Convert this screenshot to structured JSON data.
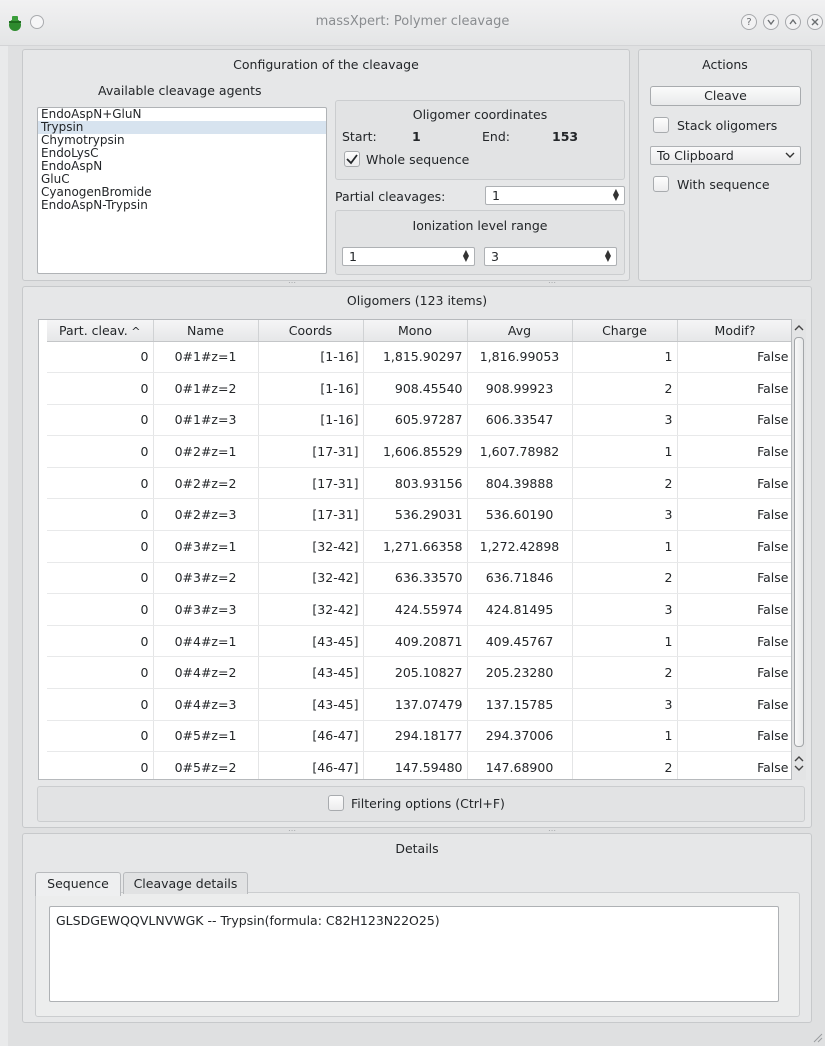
{
  "window": {
    "title": "massXpert: Polymer cleavage"
  },
  "config": {
    "title": "Configuration of the cleavage",
    "agents_label": "Available cleavage agents",
    "agents": [
      "EndoAspN+GluN",
      "Trypsin",
      "Chymotrypsin",
      "EndoLysC",
      "EndoAspN",
      "GluC",
      "CyanogenBromide",
      "EndoAspN-Trypsin"
    ],
    "selected_agent": "Trypsin",
    "coords": {
      "title": "Oligomer coordinates",
      "start_label": "Start:",
      "start_value": "1",
      "end_label": "End:",
      "end_value": "153",
      "whole_sequence_label": "Whole sequence",
      "whole_sequence_checked": true
    },
    "partial_label": "Partial cleavages:",
    "partial_value": "1",
    "ionization": {
      "title": "Ionization level range",
      "min": "1",
      "max": "3"
    }
  },
  "actions": {
    "title": "Actions",
    "cleave_label": "Cleave",
    "stack_label": "Stack oligomers",
    "export_target": "To Clipboard",
    "with_sequence_label": "With sequence"
  },
  "oligomers": {
    "title": "Oligomers (123 items)",
    "columns": [
      "Part. cleav.",
      "Name",
      "Coords",
      "Mono",
      "Avg",
      "Charge",
      "Modif?"
    ],
    "rows": [
      [
        "0",
        "0#1#z=1",
        "[1-16]",
        "1,815.90297",
        "1,816.99053",
        "1",
        "False"
      ],
      [
        "0",
        "0#1#z=2",
        "[1-16]",
        "908.45540",
        "908.99923",
        "2",
        "False"
      ],
      [
        "0",
        "0#1#z=3",
        "[1-16]",
        "605.97287",
        "606.33547",
        "3",
        "False"
      ],
      [
        "0",
        "0#2#z=1",
        "[17-31]",
        "1,606.85529",
        "1,607.78982",
        "1",
        "False"
      ],
      [
        "0",
        "0#2#z=2",
        "[17-31]",
        "803.93156",
        "804.39888",
        "2",
        "False"
      ],
      [
        "0",
        "0#2#z=3",
        "[17-31]",
        "536.29031",
        "536.60190",
        "3",
        "False"
      ],
      [
        "0",
        "0#3#z=1",
        "[32-42]",
        "1,271.66358",
        "1,272.42898",
        "1",
        "False"
      ],
      [
        "0",
        "0#3#z=2",
        "[32-42]",
        "636.33570",
        "636.71846",
        "2",
        "False"
      ],
      [
        "0",
        "0#3#z=3",
        "[32-42]",
        "424.55974",
        "424.81495",
        "3",
        "False"
      ],
      [
        "0",
        "0#4#z=1",
        "[43-45]",
        "409.20871",
        "409.45767",
        "1",
        "False"
      ],
      [
        "0",
        "0#4#z=2",
        "[43-45]",
        "205.10827",
        "205.23280",
        "2",
        "False"
      ],
      [
        "0",
        "0#4#z=3",
        "[43-45]",
        "137.07479",
        "137.15785",
        "3",
        "False"
      ],
      [
        "0",
        "0#5#z=1",
        "[46-47]",
        "294.18177",
        "294.37006",
        "1",
        "False"
      ],
      [
        "0",
        "0#5#z=2",
        "[46-47]",
        "147.59480",
        "147.68900",
        "2",
        "False"
      ]
    ],
    "filter_label": "Filtering options (Ctrl+F)"
  },
  "details": {
    "title": "Details",
    "tabs": [
      "Sequence",
      "Cleavage details"
    ],
    "active_tab": "Sequence",
    "sequence_text": "GLSDGEWQQVLNVWGK -- Trypsin(formula: C82H123N22O25)"
  }
}
